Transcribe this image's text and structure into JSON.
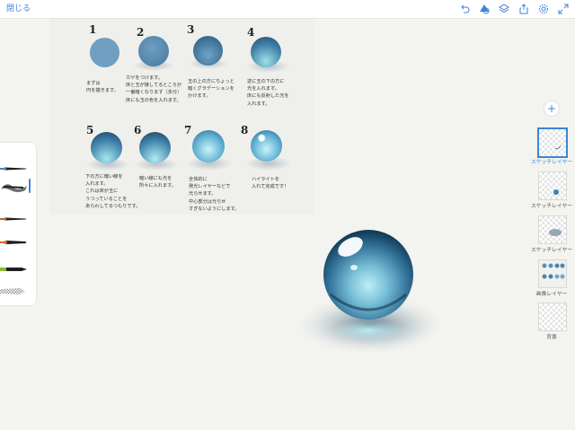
{
  "topbar": {
    "close_label": "閉じる",
    "icons": [
      "undo-icon",
      "layer-effects-icon",
      "layers-icon",
      "share-icon",
      "settings-icon",
      "expand-icon"
    ]
  },
  "reference": {
    "steps": [
      {
        "num": "1",
        "text": "まずは\n円を描きます。"
      },
      {
        "num": "2",
        "text": "カゲをつけます。\n床と玉が接してるところが\n一番暗くなります（多分）\n床にも玉の色を入れます。"
      },
      {
        "num": "3",
        "text": "玉の上の方にちょっと\n暗くグラデーションを\nかけます。"
      },
      {
        "num": "4",
        "text": "逆に玉の下の方に\n光を入れます。\n床にも反射した光を\n入れます。"
      },
      {
        "num": "5",
        "text": "下の方に暗い線を\n入れます。\nこれは床が玉に\nうつっていることを\nあらわしてるつもりです。"
      },
      {
        "num": "6",
        "text": "暗い線にも光を\n所々に入れます。"
      },
      {
        "num": "7",
        "text": "全体的に\n発光レイヤーなどで\n光らせます。\n中心部分は光らせ\nすぎないようにします。"
      },
      {
        "num": "8",
        "text": "ハイライトを\n入れて完成です！"
      }
    ]
  },
  "brushes": [
    "brush-1",
    "brush-2",
    "brush-3",
    "brush-4",
    "brush-5",
    "brush-6"
  ],
  "layers": {
    "add_label": "+",
    "items": [
      {
        "label": "スケッチレイヤー",
        "selected": true
      },
      {
        "label": "スケッチレイヤー",
        "selected": false
      },
      {
        "label": "スケッチレイヤー",
        "selected": false
      },
      {
        "label": "画像レイヤー",
        "selected": false
      },
      {
        "label": "背景",
        "selected": false
      }
    ]
  },
  "colors": {
    "accent": "#3b86d6",
    "canvas": "#f3f3ef",
    "ball": "#4e9ac0"
  }
}
